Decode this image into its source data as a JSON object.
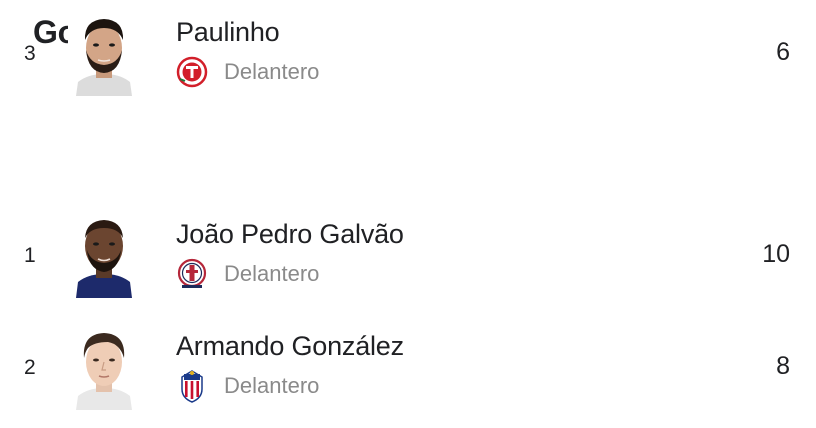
{
  "header": {
    "title": "Goles"
  },
  "players": [
    {
      "rank": "1",
      "name": "João Pedro Galvão",
      "position": "Delantero",
      "goals": "10",
      "team_crest": "atletico-san-luis-crest",
      "photo": "player-photo"
    },
    {
      "rank": "2",
      "name": "Armando González",
      "position": "Delantero",
      "goals": "8",
      "team_crest": "chivas-guadalajara-crest",
      "photo": "player-photo"
    },
    {
      "rank": "3",
      "name": "Paulinho",
      "position": "Delantero",
      "goals": "6",
      "team_crest": "toluca-crest",
      "photo": "player-photo"
    }
  ],
  "colors": {
    "text": "#202124",
    "muted": "#8a8a8a",
    "san_luis_red": "#b5273a",
    "chivas_red": "#c8102e",
    "chivas_blue": "#1a3a8a",
    "toluca_red": "#d21f2a"
  }
}
